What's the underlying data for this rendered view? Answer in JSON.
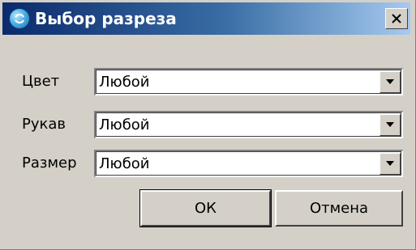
{
  "window": {
    "title": "Выбор разреза",
    "close_glyph": "✕"
  },
  "fields": [
    {
      "label": "Цвет",
      "value": "Любой"
    },
    {
      "label": "Рукав",
      "value": "Любой"
    },
    {
      "label": "Размер",
      "value": "Любой"
    }
  ],
  "buttons": {
    "ok_label": "ОК",
    "cancel_label": "Отмена"
  },
  "icons": {
    "app": "round-blue-app-icon",
    "close": "close-icon",
    "dropdown": "chevron-down-icon"
  },
  "colors": {
    "dialog_bg": "#d4d0c8",
    "titlebar_start": "#0b2a6b",
    "titlebar_end": "#a6caf0"
  }
}
